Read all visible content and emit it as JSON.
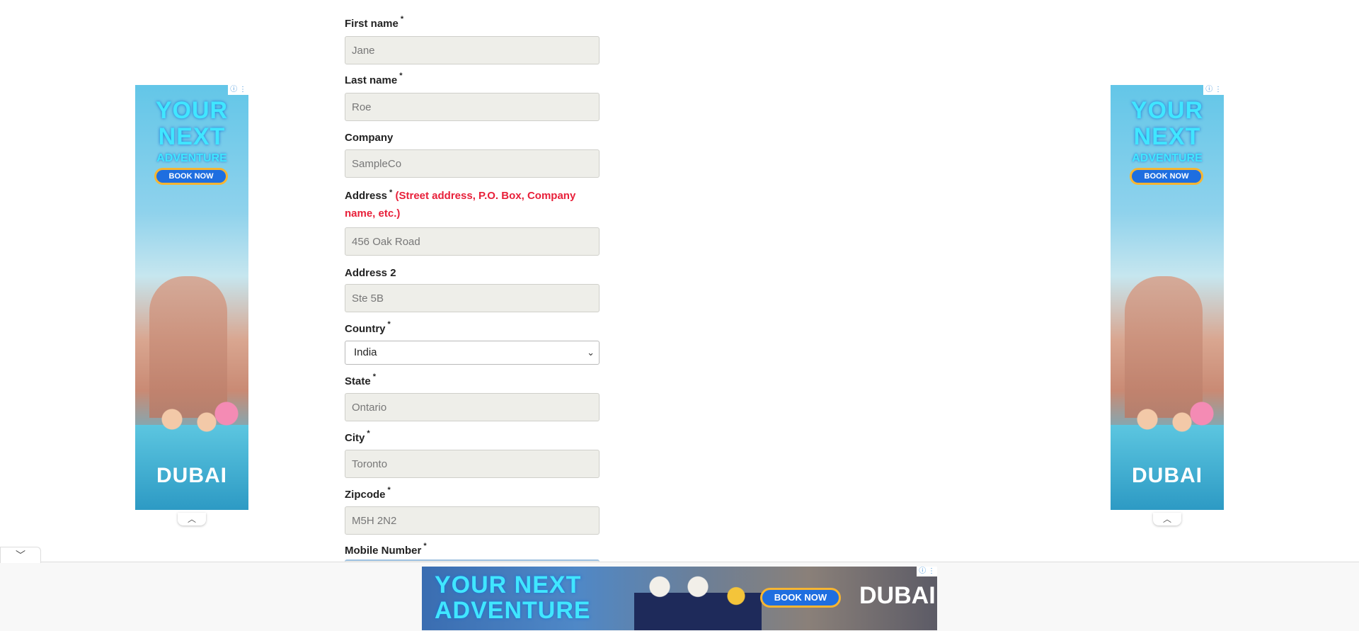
{
  "form": {
    "first_name": {
      "label": "First name",
      "required_mark": "*",
      "value": "Jane"
    },
    "last_name": {
      "label": "Last name",
      "required_mark": "*",
      "value": "Roe"
    },
    "company": {
      "label": "Company",
      "value": "SampleCo"
    },
    "address": {
      "label": "Address",
      "required_mark": "*",
      "hint": "(Street address, P.O. Box, Company name, etc.)",
      "value": "456 Oak Road"
    },
    "address2": {
      "label": "Address 2",
      "value": "Ste 5B"
    },
    "country": {
      "label": "Country",
      "required_mark": "*",
      "selected": "India"
    },
    "state": {
      "label": "State",
      "required_mark": "*",
      "value": "Ontario"
    },
    "city": {
      "label": "City",
      "required_mark": "*",
      "value": "Toronto"
    },
    "zipcode": {
      "label": "Zipcode",
      "required_mark": "*",
      "value": "M5H 2N2"
    },
    "mobile": {
      "label": "Mobile Number",
      "required_mark": "*"
    }
  },
  "ads": {
    "side_headline": "YOUR NEXT",
    "side_sub": "ADVENTURE",
    "book_label": "BOOK NOW",
    "brand": "DUBAI",
    "banner_headline": "YOUR NEXT ADVENTURE",
    "info_badge": "ⓘ ⋮"
  },
  "icons": {
    "collapse_up": "︿",
    "collapse_down": "﹀"
  }
}
